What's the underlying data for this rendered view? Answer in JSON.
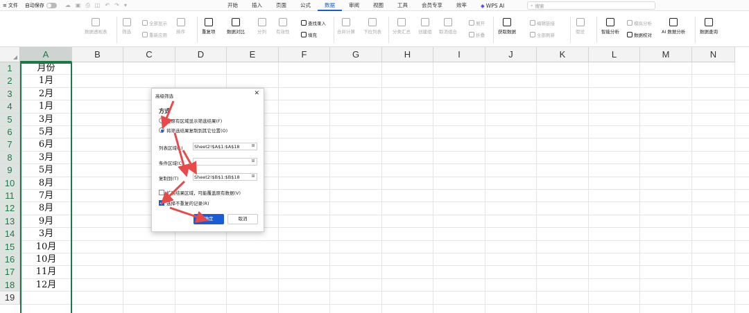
{
  "topbar": {
    "file_label": "文件",
    "autosave_label": "自动保存",
    "tabs": [
      "开始",
      "插入",
      "页面",
      "公式",
      "数据",
      "审阅",
      "视图",
      "工具",
      "会员专享",
      "效率"
    ],
    "active_tab": "数据",
    "wps_ai_label": "WPS AI",
    "search_placeholder": "搜索"
  },
  "ribbon": {
    "pivot": "数据透视表",
    "filter": "筛选",
    "show_all": "全部显示",
    "reapply": "重新应用",
    "sort": "排序",
    "dup": "重复项",
    "compare": "数据对比",
    "split": "分列",
    "validity": "有效性",
    "lookup_entry": "查找录入",
    "fill": "填充",
    "merge_calc": "合并计算",
    "dropdown": "下拉列表",
    "subtotal": "分类汇总",
    "group": "创建组",
    "ungroup": "取消组合",
    "expand": "展开",
    "collapse": "折叠",
    "get_data": "获取数据",
    "edit_links": "编辑链接",
    "refresh_all": "全部刷新",
    "forecast": "假设",
    "smart_analysis": "智能分析",
    "sim_analysis": "模拟分析",
    "data_verify": "数据校对",
    "ai_analysis": "AI 数据分析",
    "data_query": "数据查询"
  },
  "sheet": {
    "columns": [
      "A",
      "B",
      "C",
      "D",
      "E",
      "F",
      "G",
      "H",
      "I",
      "J",
      "K",
      "L",
      "M",
      "N"
    ],
    "rows": [
      "1",
      "2",
      "3",
      "4",
      "5",
      "6",
      "7",
      "8",
      "9",
      "10",
      "11",
      "12",
      "13",
      "14",
      "15",
      "16",
      "17",
      "18",
      "19"
    ],
    "col_a": [
      "月份",
      "1月",
      "2月",
      "1月",
      "3月",
      "5月",
      "6月",
      "3月",
      "5月",
      "8月",
      "7月",
      "8月",
      "9月",
      "3月",
      "10月",
      "10月",
      "11月",
      "12月",
      ""
    ]
  },
  "dialog": {
    "title": "高级筛选",
    "method_label": "方式",
    "opt1": "在原有区域显示筛选结果(F)",
    "opt2": "将筛选结果复制到其它位置(O)",
    "list_label": "列表区域(L)",
    "list_value": "Sheet2!$A$1:$A$18",
    "criteria_label": "条件区域(C)",
    "criteria_value": "",
    "copy_label": "复制到(T)",
    "copy_value": "Sheet2!$B$1:$B$18",
    "extend_label": "扩展结果区域，可能覆盖原有数据(V)",
    "unique_label": "选择不重复的记录(R)",
    "ok": "确定",
    "cancel": "取消"
  },
  "colors": {
    "accent": "#1a5bd6",
    "selection": "#1b7a44",
    "arrow": "#e84a4a"
  }
}
